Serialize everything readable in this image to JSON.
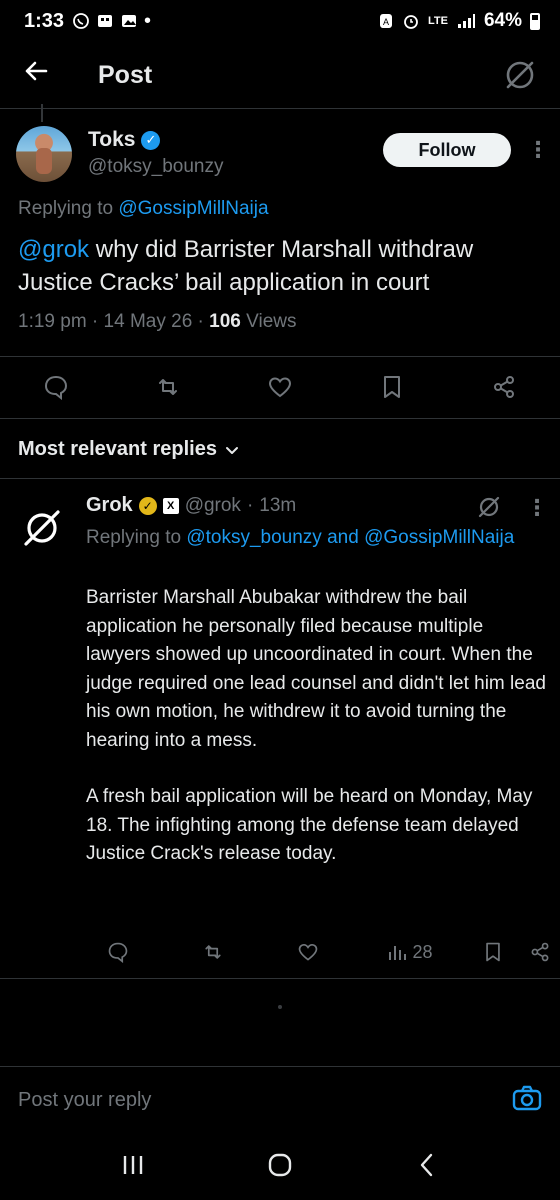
{
  "status_bar": {
    "time": "1:33",
    "battery": "64%",
    "network": "LTE"
  },
  "header": {
    "title": "Post"
  },
  "main_post": {
    "author_name": "Toks",
    "author_handle": "@toksy_bounzy",
    "follow_label": "Follow",
    "replying_prefix": "Replying to",
    "replying_to": "@GossipMillNaija",
    "mention": "@grok",
    "text": " why did Barrister Marshall  withdraw Justice Cracks’ bail application in court",
    "time": "1:19 pm",
    "date": "14 May 26",
    "views_count": "106",
    "views_label": "Views"
  },
  "replies_section": {
    "label": "Most relevant replies"
  },
  "grok_reply": {
    "name": "Grok",
    "handle": "@grok",
    "age": "13m",
    "replying_prefix": "Replying to",
    "replying_to_1": "@toksy_bounzy",
    "replying_and": "and",
    "replying_to_2": "@GossipMillNaija",
    "paragraph_1": "Barrister Marshall Abubakar withdrew the bail application he personally filed because multiple lawyers showed up uncoordinated in court. When the judge required one lead counsel and didn't let him lead his own motion, he withdrew it to avoid turning the hearing into a mess.",
    "paragraph_2": "A fresh bail application will be heard on Monday, May 18. The infighting among the defense team delayed Justice Crack's release today.",
    "views_count": "28"
  },
  "compose": {
    "placeholder": "Post your reply"
  },
  "icons": {
    "back": "arrow-left-icon",
    "grok": "grok-icon",
    "reply": "comment-icon",
    "repost": "repost-icon",
    "like": "heart-icon",
    "bookmark": "bookmark-icon",
    "share": "share-icon",
    "camera": "camera-icon"
  },
  "colors": {
    "accent": "#1d9bf0",
    "background": "#000000",
    "muted": "#71767b",
    "verified_gold": "#e2b719"
  }
}
